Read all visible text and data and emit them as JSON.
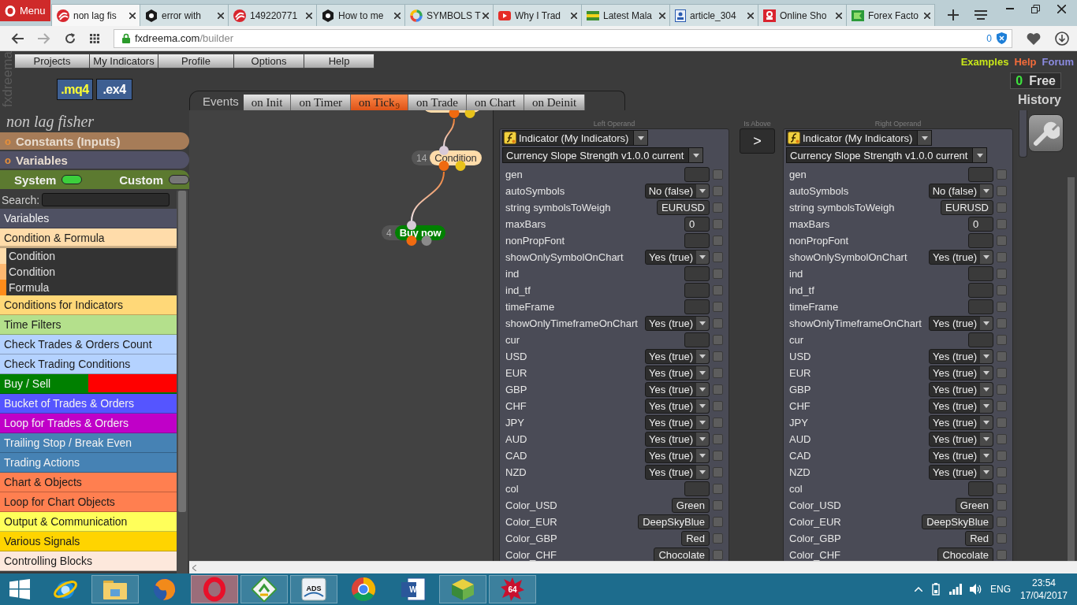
{
  "browser": {
    "menu_button": "Menu",
    "tabs": [
      {
        "title": "non lag fis",
        "selected": true
      },
      {
        "title": "error with",
        "selected": false
      },
      {
        "title": "149220771",
        "selected": false
      },
      {
        "title": "How to me",
        "selected": false
      },
      {
        "title": "SYMBOLS T",
        "selected": false
      },
      {
        "title": "Why I Trad",
        "selected": false
      },
      {
        "title": "Latest Mala",
        "selected": false
      },
      {
        "title": "article_304",
        "selected": false
      },
      {
        "title": "Online Sho",
        "selected": false
      },
      {
        "title": "Forex Facto",
        "selected": false
      }
    ],
    "url_host": "fxdreema.com",
    "url_path": "/builder",
    "blocked_count": "0"
  },
  "header": {
    "logo": "fxdreema",
    "menu": [
      "Projects",
      "My Indicators",
      "Profile",
      "Options",
      "Help"
    ],
    "file_buttons": [
      {
        "label": ".mq4",
        "kind": "source"
      },
      {
        "label": ".ex4",
        "kind": "binary"
      }
    ],
    "links": [
      {
        "label": "Examples",
        "color": "#c8e619"
      },
      {
        "label": "Help",
        "color": "#f26b3a"
      },
      {
        "label": "Forum",
        "color": "#8b8be0"
      }
    ],
    "free_count": "0",
    "free_label": "Free",
    "history": "History"
  },
  "events": {
    "label": "Events",
    "tabs": [
      {
        "label": "on Init",
        "selected": false
      },
      {
        "label": "on Timer",
        "selected": false
      },
      {
        "label": "on Tick",
        "selected": true,
        "count": "9"
      },
      {
        "label": "on Trade",
        "selected": false
      },
      {
        "label": "on Chart",
        "selected": false
      },
      {
        "label": "on Deinit",
        "selected": false
      }
    ]
  },
  "sidebar": {
    "project": "non lag fisher",
    "sections": [
      {
        "marker": "o",
        "label": "Constants (Inputs)",
        "color": "#a67c58"
      },
      {
        "marker": "o",
        "label": "Variables",
        "color": "#515166"
      }
    ],
    "filters": [
      {
        "label": "System",
        "on": true
      },
      {
        "label": "Custom",
        "on": false
      }
    ],
    "search_label": "Search:",
    "categories": [
      {
        "label": "Variables",
        "color": "#4f5163",
        "expanded": false
      },
      {
        "label": "Condition & Formula",
        "color": "#ffdcaa",
        "expanded": true,
        "children": [
          {
            "label": "Condition",
            "color": "#ffdcaa"
          },
          {
            "label": "Condition",
            "color": "#ffb870"
          },
          {
            "label": "Formula",
            "color": "#ff8c1a"
          }
        ]
      },
      {
        "label": "Conditions for Indicators",
        "color": "#ffd878",
        "expanded": false
      },
      {
        "label": "Time Filters",
        "color": "#b4e08c",
        "expanded": false
      },
      {
        "label": "Check Trades & Orders Count",
        "color": "#b4d2ff",
        "expanded": false
      },
      {
        "label": "Check Trading Conditions",
        "color": "#b4d2ff",
        "expanded": false
      },
      {
        "label": "Buy / Sell",
        "segments": [
          {
            "color": "#008000"
          },
          {
            "color": "#ff0000"
          }
        ],
        "expanded": false
      },
      {
        "label": "Bucket of Trades & Orders",
        "color": "#5555ff",
        "expanded": false
      },
      {
        "label": "Loop for Trades & Orders",
        "color": "#c000c8",
        "expanded": false
      },
      {
        "label": "Trailing Stop / Break Even",
        "color": "#4682b4",
        "expanded": false
      },
      {
        "label": "Trading Actions",
        "color": "#4682b4",
        "expanded": false
      },
      {
        "label": "Chart & Objects",
        "color": "#ff7f50",
        "expanded": false
      },
      {
        "label": "Loop for Chart Objects",
        "color": "#ff7f50",
        "expanded": false
      },
      {
        "label": "Output & Communication",
        "color": "#ffff5a",
        "expanded": false
      },
      {
        "label": "Various Signals",
        "color": "#ffd400",
        "expanded": false
      },
      {
        "label": "Controlling Blocks",
        "color": "#fde8dc",
        "expanded": false
      }
    ]
  },
  "canvas": {
    "nodes": [
      {
        "kind": "condition",
        "color": "#ffdcaa"
      },
      {
        "kind": "condition",
        "number": "14",
        "label": "Condition",
        "color": "#ffdcaa"
      },
      {
        "kind": "action",
        "number": "4",
        "label": "Buy now",
        "color": "#008000"
      }
    ]
  },
  "condition": {
    "operator_label": "Is Above",
    "operator": ">",
    "operands": [
      {
        "label": "Left Operand",
        "source": "Indicator (My Indicators)",
        "indicator": "Currency Slope Strength v1.0.0 current",
        "params": [
          {
            "name": "gen",
            "kind": "input",
            "checked": false
          },
          {
            "name": "autoSymbols",
            "kind": "select",
            "value": "No (false)",
            "checked": false
          },
          {
            "name": "string symbolsToWeigh",
            "kind": "input",
            "value": "EURUSD",
            "checked": false
          },
          {
            "name": "maxBars",
            "kind": "input",
            "value": "0",
            "checked": false
          },
          {
            "name": "nonPropFont",
            "kind": "input",
            "checked": false
          },
          {
            "name": "showOnlySymbolOnChart",
            "kind": "select",
            "value": "Yes (true)",
            "checked": false
          },
          {
            "name": "ind",
            "kind": "input",
            "checked": false
          },
          {
            "name": "ind_tf",
            "kind": "input",
            "checked": false
          },
          {
            "name": "timeFrame",
            "kind": "input",
            "checked": false
          },
          {
            "name": "showOnlyTimeframeOnChart",
            "kind": "select",
            "value": "Yes (true)",
            "checked": false
          },
          {
            "name": "cur",
            "kind": "input",
            "checked": false
          },
          {
            "name": "USD",
            "kind": "select",
            "value": "Yes (true)",
            "checked": false
          },
          {
            "name": "EUR",
            "kind": "select",
            "value": "Yes (true)",
            "checked": false
          },
          {
            "name": "GBP",
            "kind": "select",
            "value": "Yes (true)",
            "checked": false
          },
          {
            "name": "CHF",
            "kind": "select",
            "value": "Yes (true)",
            "checked": false
          },
          {
            "name": "JPY",
            "kind": "select",
            "value": "Yes (true)",
            "checked": false
          },
          {
            "name": "AUD",
            "kind": "select",
            "value": "Yes (true)",
            "checked": false
          },
          {
            "name": "CAD",
            "kind": "select",
            "value": "Yes (true)",
            "checked": false
          },
          {
            "name": "NZD",
            "kind": "select",
            "value": "Yes (true)",
            "checked": false
          },
          {
            "name": "col",
            "kind": "input",
            "checked": false
          },
          {
            "name": "Color_USD",
            "kind": "input",
            "value": "Green",
            "checked": false
          },
          {
            "name": "Color_EUR",
            "kind": "input",
            "value": "DeepSkyBlue",
            "checked": false
          },
          {
            "name": "Color_GBP",
            "kind": "input",
            "value": "Red",
            "checked": false
          },
          {
            "name": "Color_CHF",
            "kind": "input",
            "value": "Chocolate",
            "checked": false
          }
        ]
      },
      {
        "label": "Right Operand",
        "source": "Indicator (My Indicators)",
        "indicator": "Currency Slope Strength v1.0.0 current",
        "params": [
          {
            "name": "gen",
            "kind": "input",
            "checked": false
          },
          {
            "name": "autoSymbols",
            "kind": "select",
            "value": "No (false)",
            "checked": false
          },
          {
            "name": "string symbolsToWeigh",
            "kind": "input",
            "value": "EURUSD",
            "checked": false
          },
          {
            "name": "maxBars",
            "kind": "input",
            "value": "0",
            "checked": false
          },
          {
            "name": "nonPropFont",
            "kind": "input",
            "checked": false
          },
          {
            "name": "showOnlySymbolOnChart",
            "kind": "select",
            "value": "Yes (true)",
            "checked": false
          },
          {
            "name": "ind",
            "kind": "input",
            "checked": false
          },
          {
            "name": "ind_tf",
            "kind": "input",
            "checked": false
          },
          {
            "name": "timeFrame",
            "kind": "input",
            "checked": false
          },
          {
            "name": "showOnlyTimeframeOnChart",
            "kind": "select",
            "value": "Yes (true)",
            "checked": false
          },
          {
            "name": "cur",
            "kind": "input",
            "checked": false
          },
          {
            "name": "USD",
            "kind": "select",
            "value": "Yes (true)",
            "checked": false
          },
          {
            "name": "EUR",
            "kind": "select",
            "value": "Yes (true)",
            "checked": false
          },
          {
            "name": "GBP",
            "kind": "select",
            "value": "Yes (true)",
            "checked": false
          },
          {
            "name": "CHF",
            "kind": "select",
            "value": "Yes (true)",
            "checked": false
          },
          {
            "name": "JPY",
            "kind": "select",
            "value": "Yes (true)",
            "checked": false
          },
          {
            "name": "AUD",
            "kind": "select",
            "value": "Yes (true)",
            "checked": false
          },
          {
            "name": "CAD",
            "kind": "select",
            "value": "Yes (true)",
            "checked": false
          },
          {
            "name": "NZD",
            "kind": "select",
            "value": "Yes (true)",
            "checked": false
          },
          {
            "name": "col",
            "kind": "input",
            "checked": false
          },
          {
            "name": "Color_USD",
            "kind": "input",
            "value": "Green",
            "checked": false
          },
          {
            "name": "Color_EUR",
            "kind": "input",
            "value": "DeepSkyBlue",
            "checked": false
          },
          {
            "name": "Color_GBP",
            "kind": "input",
            "value": "Red",
            "checked": false
          },
          {
            "name": "Color_CHF",
            "kind": "input",
            "value": "Chocolate",
            "checked": false
          }
        ]
      }
    ]
  },
  "taskbar": {
    "apps": [
      {
        "kind": "globe",
        "running": false,
        "selected": false
      },
      {
        "kind": "folder",
        "running": true,
        "selected": false
      },
      {
        "kind": "fox",
        "running": false,
        "selected": false
      },
      {
        "kind": "ring",
        "running": true,
        "selected": true
      },
      {
        "kind": "arrows",
        "running": true,
        "selected": false
      },
      {
        "kind": "tile",
        "text": "ADS",
        "running": true,
        "selected": false
      },
      {
        "kind": "wheel",
        "running": false,
        "selected": false
      },
      {
        "kind": "document",
        "text": "W",
        "running": false,
        "selected": false
      },
      {
        "kind": "book",
        "running": true,
        "selected": false
      },
      {
        "kind": "splat",
        "text": "64",
        "running": true,
        "selected": false
      }
    ],
    "language": "ENG",
    "time": "23:54",
    "date": "17/04/2017"
  }
}
